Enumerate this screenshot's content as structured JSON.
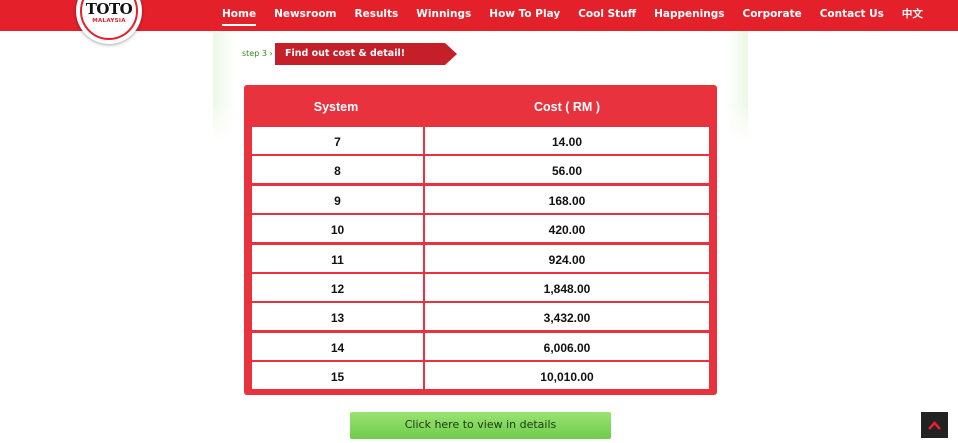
{
  "logo": {
    "text": "TOTO",
    "sub": "MALAYSIA"
  },
  "nav": {
    "items": [
      {
        "label": "Home",
        "name": "home"
      },
      {
        "label": "Newsroom",
        "name": "newsroom"
      },
      {
        "label": "Results",
        "name": "results"
      },
      {
        "label": "Winnings",
        "name": "winnings"
      },
      {
        "label": "How To Play",
        "name": "how-to-play"
      },
      {
        "label": "Cool Stuff",
        "name": "cool-stuff"
      },
      {
        "label": "Happenings",
        "name": "happenings"
      },
      {
        "label": "Corporate",
        "name": "corporate"
      },
      {
        "label": "Contact Us",
        "name": "contact-us"
      },
      {
        "label": "中文",
        "name": "chinese"
      }
    ],
    "active_index": 0
  },
  "step": {
    "label": "step 3 ›",
    "banner": "Find out cost & detail!"
  },
  "table": {
    "headers": {
      "system": "System",
      "cost": "Cost ( RM )"
    },
    "rows": [
      {
        "system": "7",
        "cost": "14.00"
      },
      {
        "system": "8",
        "cost": "56.00"
      },
      {
        "system": "9",
        "cost": "168.00"
      },
      {
        "system": "10",
        "cost": "420.00"
      },
      {
        "system": "11",
        "cost": "924.00"
      },
      {
        "system": "12",
        "cost": "1,848.00"
      },
      {
        "system": "13",
        "cost": "3,432.00"
      },
      {
        "system": "14",
        "cost": "6,006.00"
      },
      {
        "system": "15",
        "cost": "10,010.00"
      }
    ]
  },
  "details_button": {
    "label": "Click here to view in details"
  },
  "colors": {
    "brand_red": "#e4202a",
    "table_red": "#e8333f",
    "button_green": "#7fd65a"
  },
  "icons": {
    "scroll_top": "chevron-up-icon"
  }
}
